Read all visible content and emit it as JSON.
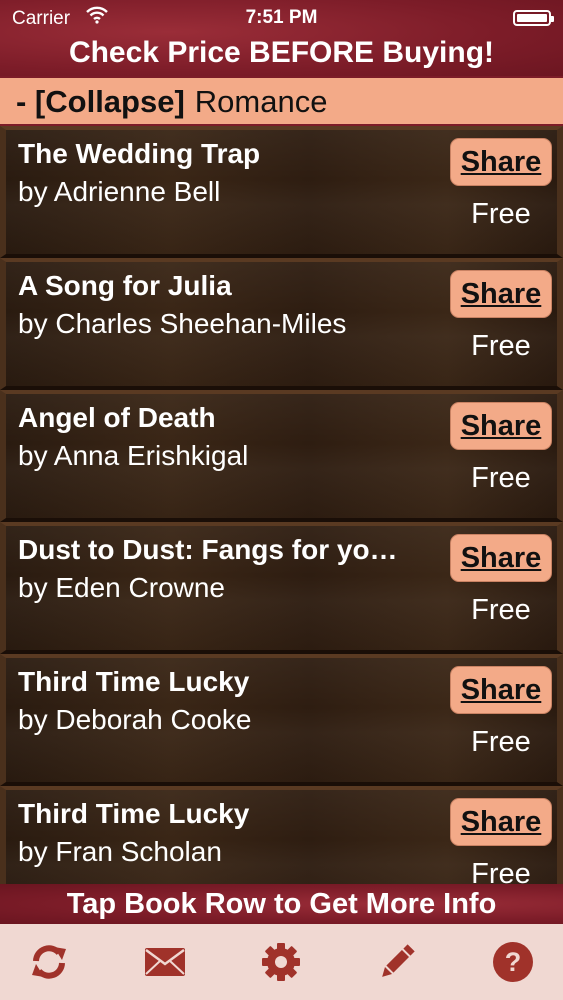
{
  "status": {
    "carrier": "Carrier",
    "time": "7:51 PM"
  },
  "header": {
    "title": "Check Price BEFORE Buying!"
  },
  "section": {
    "collapse_label": "- [Collapse]",
    "name": "Romance"
  },
  "books": [
    {
      "title": "The Wedding Trap",
      "author": "by Adrienne Bell",
      "share": "Share",
      "price": "Free"
    },
    {
      "title": "A Song for Julia",
      "author": "by Charles Sheehan-Miles",
      "share": "Share",
      "price": "Free"
    },
    {
      "title": "Angel of Death",
      "author": "by Anna Erishkigal",
      "share": "Share",
      "price": "Free"
    },
    {
      "title": "Dust to Dust: Fangs for yo…",
      "author": "by Eden Crowne",
      "share": "Share",
      "price": "Free"
    },
    {
      "title": "Third Time Lucky",
      "author": "by Deborah Cooke",
      "share": "Share",
      "price": "Free"
    },
    {
      "title": "Third Time Lucky",
      "author": "by Fran Scholan",
      "share": "Share",
      "price": "Free"
    }
  ],
  "footer": {
    "hint": "Tap Book Row to Get More Info"
  },
  "toolbar": {
    "icons": [
      "refresh-icon",
      "mail-icon",
      "settings-icon",
      "edit-icon",
      "help-icon"
    ],
    "icon_color": "#a0322a"
  },
  "colors": {
    "accent": "#f3aa88",
    "header_bg": "#7c1c28",
    "toolbar_bg": "#f0d8d2"
  }
}
